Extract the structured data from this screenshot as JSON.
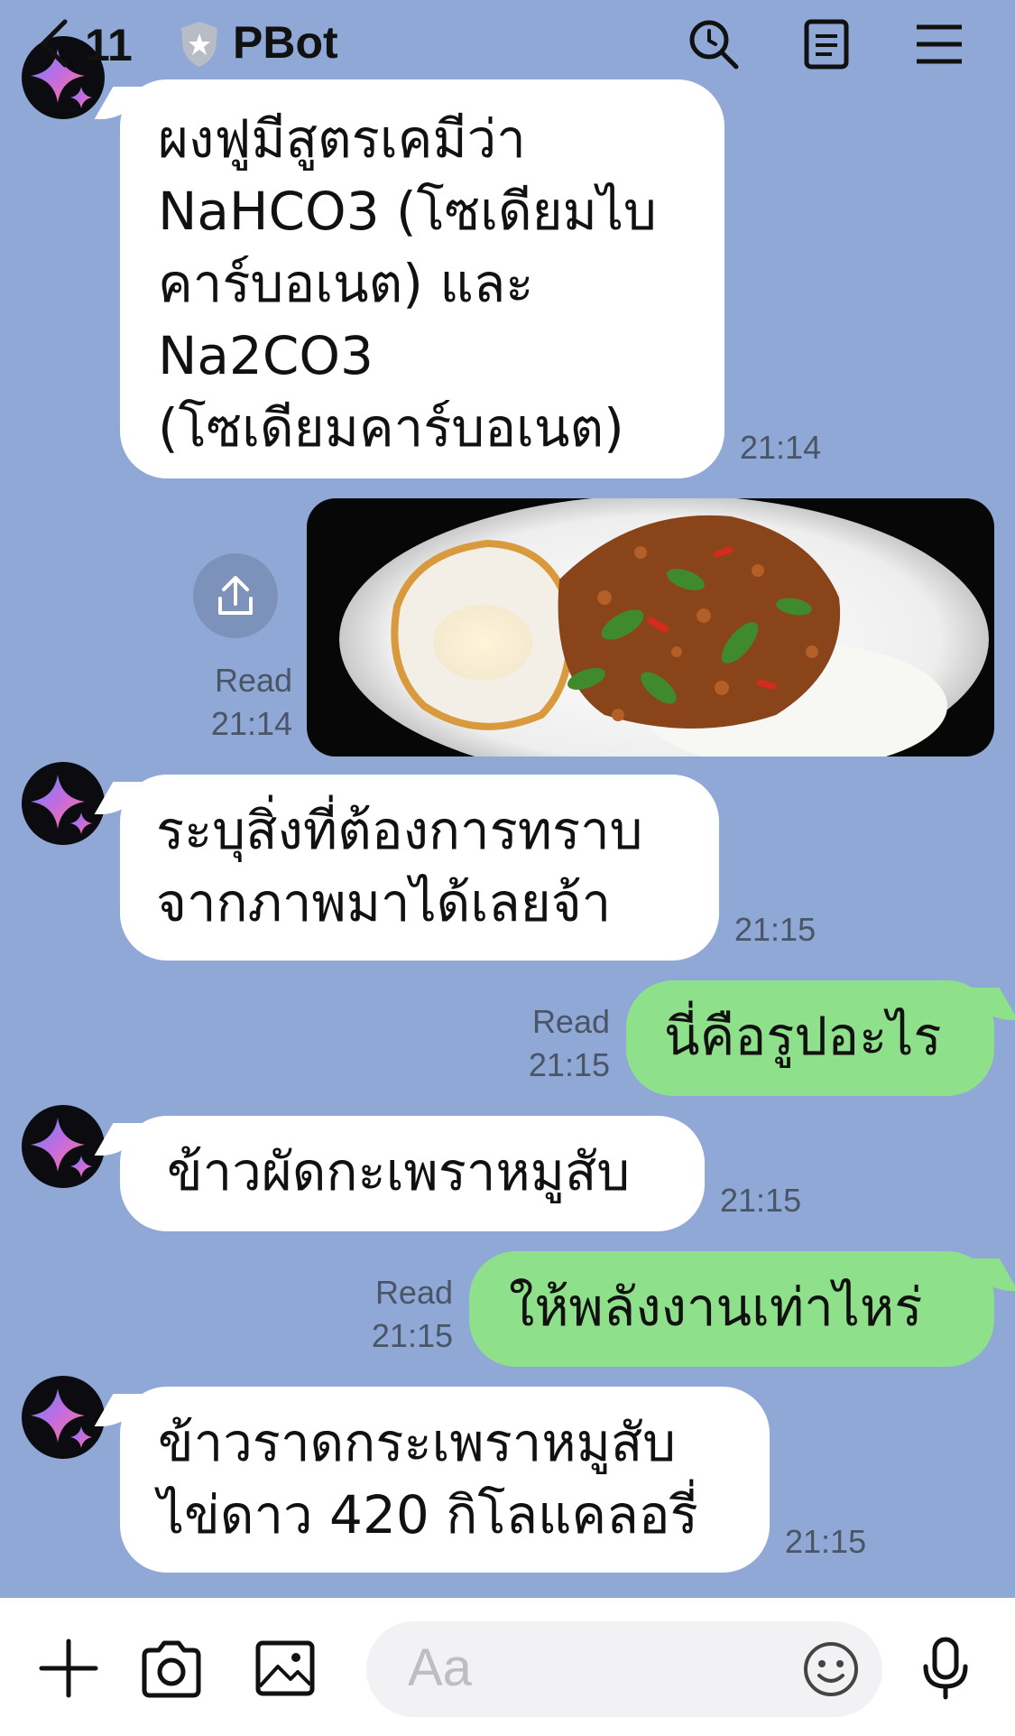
{
  "header": {
    "back_count": "11",
    "title": "PBot"
  },
  "messages": [
    {
      "lines": [
        "ผงฟูมีสูตรเคมีว่า",
        "NaHCO3 (โซเดียมไบ",
        "คาร์บอเนต) และ",
        "Na2CO3",
        "(โซเดียมคาร์บอเนต)"
      ],
      "time": "21:14"
    },
    {
      "status": "Read",
      "time": "21:14"
    },
    {
      "lines": [
        "ระบุสิ่งที่ต้องการทราบ",
        "จากภาพมาได้เลยจ้า"
      ],
      "time": "21:15"
    },
    {
      "text": "นี่คือรูปอะไร",
      "status": "Read",
      "time": "21:15"
    },
    {
      "text": "ข้าวผัดกะเพราหมูสับ",
      "time": "21:15"
    },
    {
      "text": "ให้พลังงานเท่าไหร่",
      "status": "Read",
      "time": "21:15"
    },
    {
      "lines": [
        "ข้าวราดกระเพราหมูสับ",
        "ไข่ดาว 420 กิโลแคลอรี่"
      ],
      "time": "21:15"
    }
  ],
  "footer": {
    "input_placeholder": "Aa"
  },
  "colors": {
    "background": "#8fa8d6",
    "outgoing_bubble": "#8fe08a",
    "incoming_bubble": "#ffffff"
  }
}
